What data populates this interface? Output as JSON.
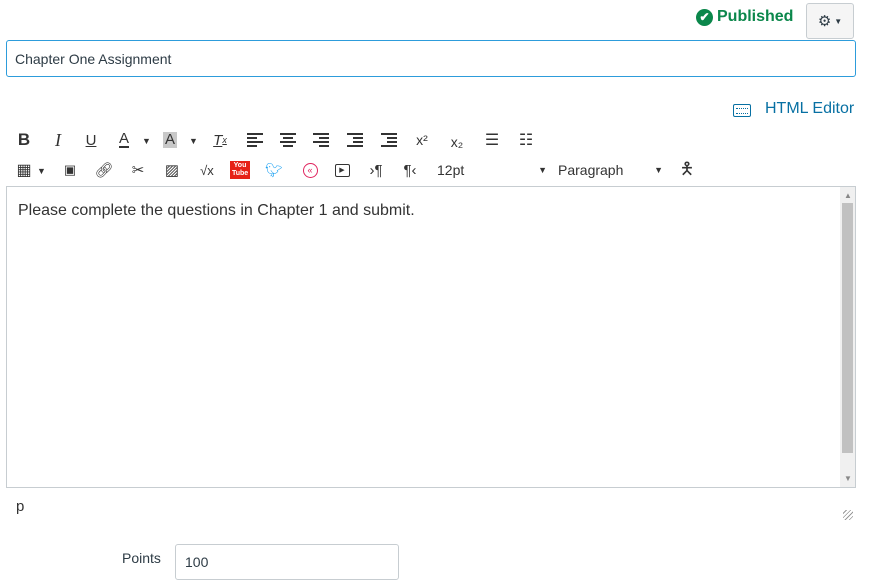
{
  "status": {
    "label": "Published",
    "color": "#0b874b"
  },
  "settings": {
    "icon": "gear-icon"
  },
  "title_field": {
    "value": "Chapter One Assignment"
  },
  "html_editor": {
    "label": "HTML Editor"
  },
  "toolbar": {
    "bold": "B",
    "italic": "I",
    "underline": "U",
    "font_color": "A",
    "bg_color": "A",
    "superscript": "x²",
    "subscript": "x₂",
    "sqrt": "√x",
    "youtube": "You Tube",
    "font_size": "12pt",
    "block_format": "Paragraph"
  },
  "editor": {
    "content": "Please complete the questions in Chapter 1 and submit.",
    "path": "p"
  },
  "points": {
    "label": "Points",
    "value": "100"
  }
}
